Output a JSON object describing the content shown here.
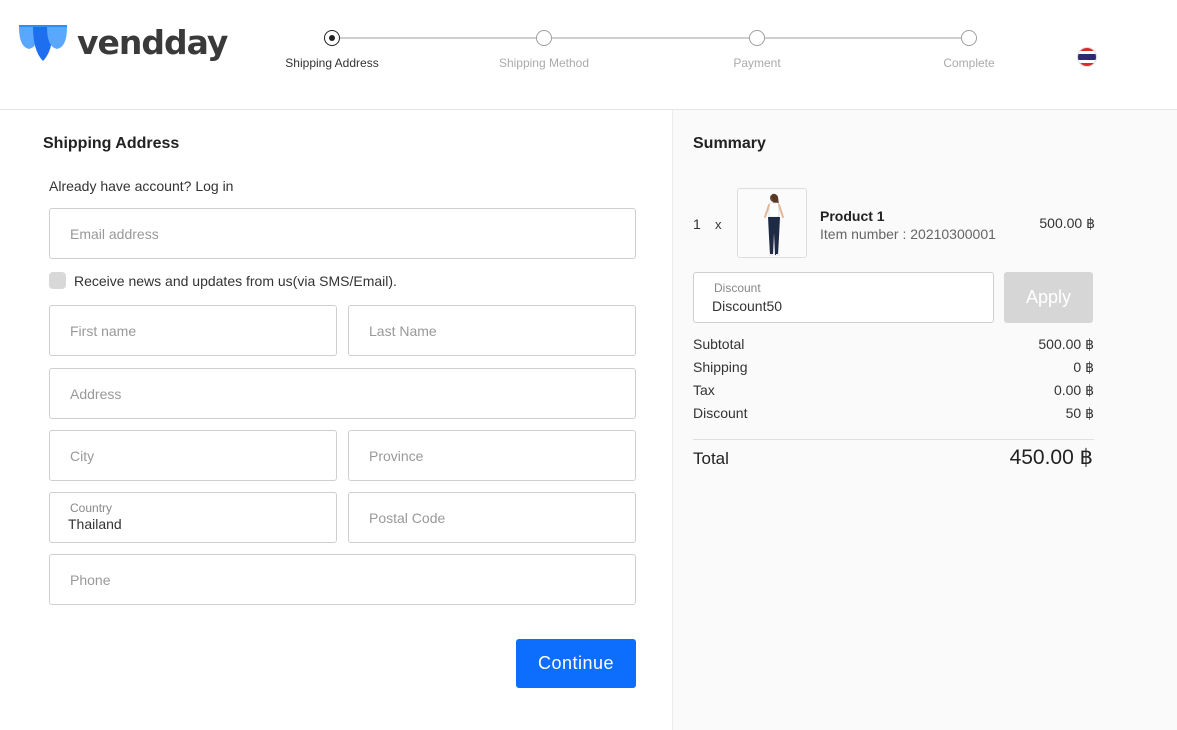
{
  "brand": {
    "name": "vendday",
    "accent": "#2f8cf5"
  },
  "steps": [
    {
      "label": "Shipping Address",
      "active": true
    },
    {
      "label": "Shipping Method",
      "active": false
    },
    {
      "label": "Payment",
      "active": false
    },
    {
      "label": "Complete",
      "active": false
    }
  ],
  "language_flag": "thailand-flag-icon",
  "shipping": {
    "title": "Shipping Address",
    "login_prompt": "Already have account? Log in",
    "email_placeholder": "Email address",
    "newsletter_label": "Receive news and updates from us(via SMS/Email).",
    "newsletter_checked": false,
    "first_name_placeholder": "First name",
    "last_name_placeholder": "Last Name",
    "address_placeholder": "Address",
    "city_placeholder": "City",
    "province_placeholder": "Province",
    "country_label": "Country",
    "country_value": "Thailand",
    "postal_placeholder": "Postal Code",
    "phone_placeholder": "Phone",
    "continue_label": "Continue",
    "continue_color": "#0d6efd"
  },
  "summary": {
    "title": "Summary",
    "item": {
      "qty": "1",
      "x": "x",
      "name": "Product 1",
      "item_number": "Item number : 20210300001",
      "price": "500.00 ฿"
    },
    "discount_label": "Discount",
    "discount_value": "Discount50",
    "apply_label": "Apply",
    "rows": [
      {
        "label": "Subtotal",
        "value": "500.00 ฿"
      },
      {
        "label": "Shipping",
        "value": "0 ฿"
      },
      {
        "label": "Tax",
        "value": "0.00 ฿"
      },
      {
        "label": "Discount",
        "value": "50 ฿"
      }
    ],
    "total_label": "Total",
    "total_value": "450.00 ฿"
  }
}
